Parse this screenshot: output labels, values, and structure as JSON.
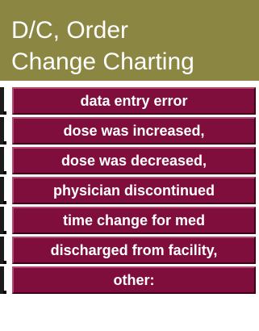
{
  "header": {
    "title_line1": "D/C, Order",
    "title_line2": "Change Charting"
  },
  "options": [
    {
      "label": "data entry error"
    },
    {
      "label": "dose was increased,"
    },
    {
      "label": "dose was decreased,"
    },
    {
      "label": "physician discontinued"
    },
    {
      "label": "time change for med"
    },
    {
      "label": "discharged from facility,"
    },
    {
      "label": "other:"
    }
  ],
  "colors": {
    "header_bg": "#8b8743",
    "button_bg": "#7f0e3c",
    "button_text": "#ffffff"
  }
}
